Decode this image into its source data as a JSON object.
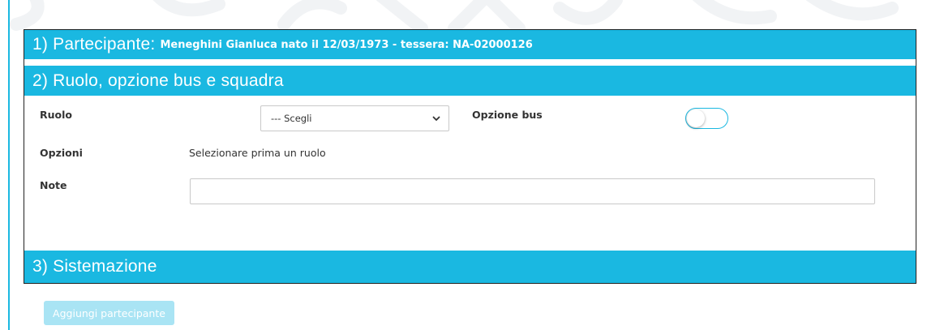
{
  "sections": {
    "partecipante": {
      "heading": "1) Partecipante:",
      "detail": "Meneghini Gianluca nato il 12/03/1973 - tessera: NA-02000126"
    },
    "ruolo": {
      "heading": "2) Ruolo, opzione bus e squadra"
    },
    "sistemazione": {
      "heading": "3) Sistemazione"
    }
  },
  "form": {
    "ruolo_label": "Ruolo",
    "ruolo_select_value": "--- Scegli",
    "opzione_bus_label": "Opzione bus",
    "opzione_bus_enabled": false,
    "opzioni_label": "Opzioni",
    "opzioni_text": "Selezionare prima un ruolo",
    "note_label": "Note",
    "note_value": ""
  },
  "actions": {
    "add_button": "Aggiungi partecipante"
  },
  "colors": {
    "accent": "#1ab8e1",
    "button_disabled": "#a9e4f4"
  },
  "icons": [
    "chevron-down-icon"
  ]
}
